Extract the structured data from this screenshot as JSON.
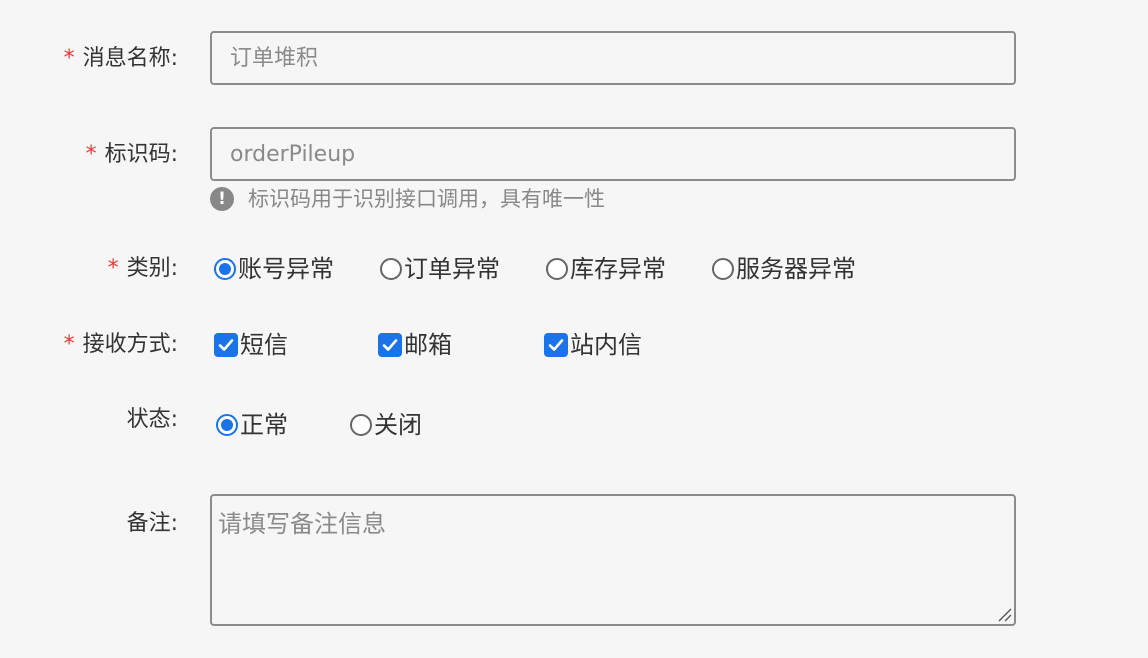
{
  "form": {
    "message_name": {
      "required_mark": "*",
      "label": "消息名称:",
      "value": "",
      "placeholder": "订单堆积"
    },
    "identifier": {
      "required_mark": "*",
      "label": "标识码:",
      "value": "",
      "placeholder": "orderPileup",
      "hint_icon": "exclamation-circle-icon",
      "hint_icon_glyph": "!",
      "hint": "标识码用于识别接口调用，具有唯一性"
    },
    "category": {
      "required_mark": "*",
      "label": "类别:",
      "options": [
        {
          "label": "账号异常",
          "selected": true
        },
        {
          "label": "订单异常",
          "selected": false
        },
        {
          "label": "库存异常",
          "selected": false
        },
        {
          "label": "服务器异常",
          "selected": false
        }
      ]
    },
    "receive_method": {
      "required_mark": "*",
      "label": "接收方式:",
      "options": [
        {
          "label": "短信",
          "checked": true
        },
        {
          "label": "邮箱",
          "checked": true
        },
        {
          "label": "站内信",
          "checked": true
        }
      ]
    },
    "status": {
      "label": "状态:",
      "options": [
        {
          "label": "正常",
          "selected": true
        },
        {
          "label": "关闭",
          "selected": false
        }
      ]
    },
    "remark": {
      "label": "备注:",
      "value": "",
      "placeholder": "请填写备注信息"
    }
  },
  "colors": {
    "accent": "#1a73e8",
    "required": "#e53935",
    "border": "#8c8c8c",
    "background": "#f6f6f6"
  }
}
